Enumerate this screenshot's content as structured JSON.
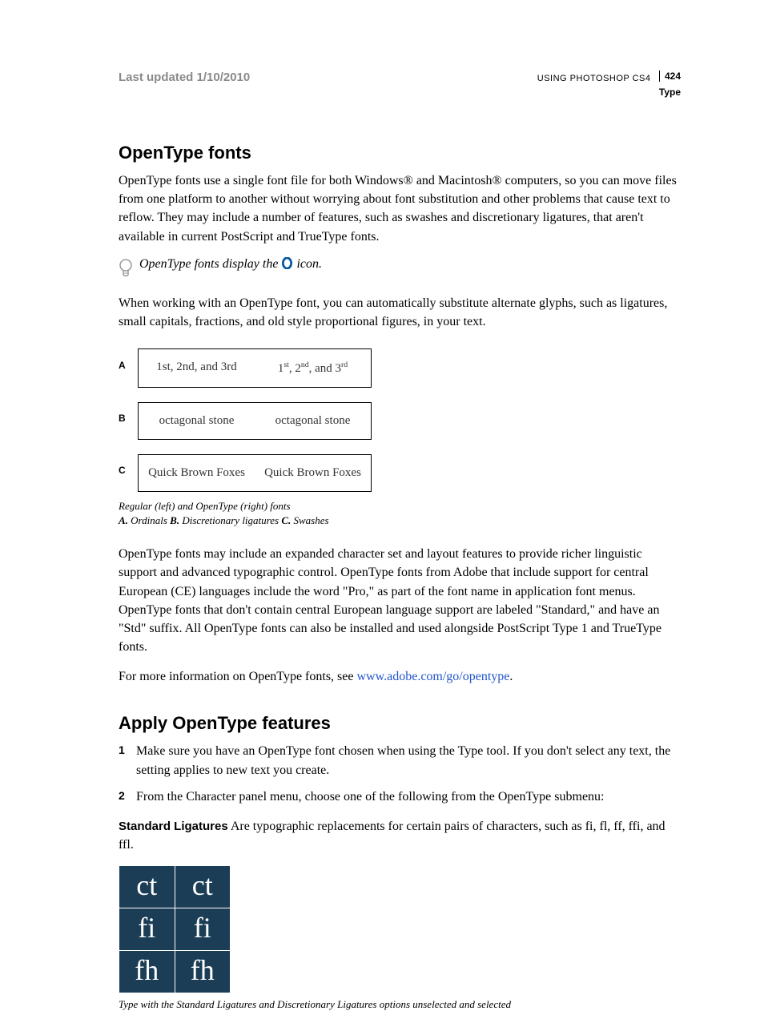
{
  "header": {
    "last_updated": "Last updated 1/10/2010",
    "doc_title": "USING PHOTOSHOP CS4",
    "page_number": "424",
    "section": "Type"
  },
  "h_opentype": "OpenType fonts",
  "p1": "OpenType fonts use a single font file for both Windows® and Macintosh® computers, so you can move files from one platform to another without worrying about font substitution and other problems that cause text to reflow. They may include a number of features, such as swashes and discretionary ligatures, that aren't available in current PostScript and TrueType fonts.",
  "tip_before": "OpenType fonts display the ",
  "tip_after": " icon.",
  "p2": "When working with an OpenType font, you can automatically substitute alternate glyphs, such as ligatures, small capitals, fractions, and old style proportional figures, in your text.",
  "figure1": {
    "labels": {
      "a": "A",
      "b": "B",
      "c": "C"
    },
    "rowA_left": "1st, 2nd, and 3rd",
    "rowB_left": "octagonal stone",
    "rowB_right": "octagonal stone",
    "rowC_left": "Quick Brown Foxes",
    "rowC_right": "Quick Brown Foxes",
    "caption": "Regular (left) and OpenType (right) fonts",
    "key_a_bold": "A.",
    "key_a": " Ordinals  ",
    "key_b_bold": "B.",
    "key_b": " Discretionary ligatures  ",
    "key_c_bold": "C.",
    "key_c": " Swashes"
  },
  "p3": "OpenType fonts may include an expanded character set and layout features to provide richer linguistic support and advanced typographic control. OpenType fonts from Adobe that include support for central European (CE) languages include the word \"Pro,\" as part of the font name in application font menus. OpenType fonts that don't contain central European language support are labeled \"Standard,\" and have an \"Std\" suffix. All OpenType fonts can also be installed and used alongside PostScript Type 1 and TrueType fonts.",
  "p4_before": "For more information on OpenType fonts, see ",
  "p4_link": "www.adobe.com/go/opentype",
  "p4_after": ".",
  "h_apply": "Apply OpenType features",
  "steps": {
    "s1": "Make sure you have an OpenType font chosen when using the Type tool. If you don't select any text, the setting applies to new text you create.",
    "s2": "From the Character panel menu, choose one of the following from the OpenType submenu:"
  },
  "def_label": "Standard Ligatures",
  "def_text": "  Are typographic replacements for certain pairs of characters, such as fi, fl, ff, ffi, and ffl.",
  "lig": {
    "r1l": "ct",
    "r1r": "ct",
    "r2l": "fi",
    "r2r": "fi",
    "r3l": "fh",
    "r3r": "fh"
  },
  "caption2": "Type with the Standard Ligatures and Discretionary Ligatures options unselected and selected"
}
